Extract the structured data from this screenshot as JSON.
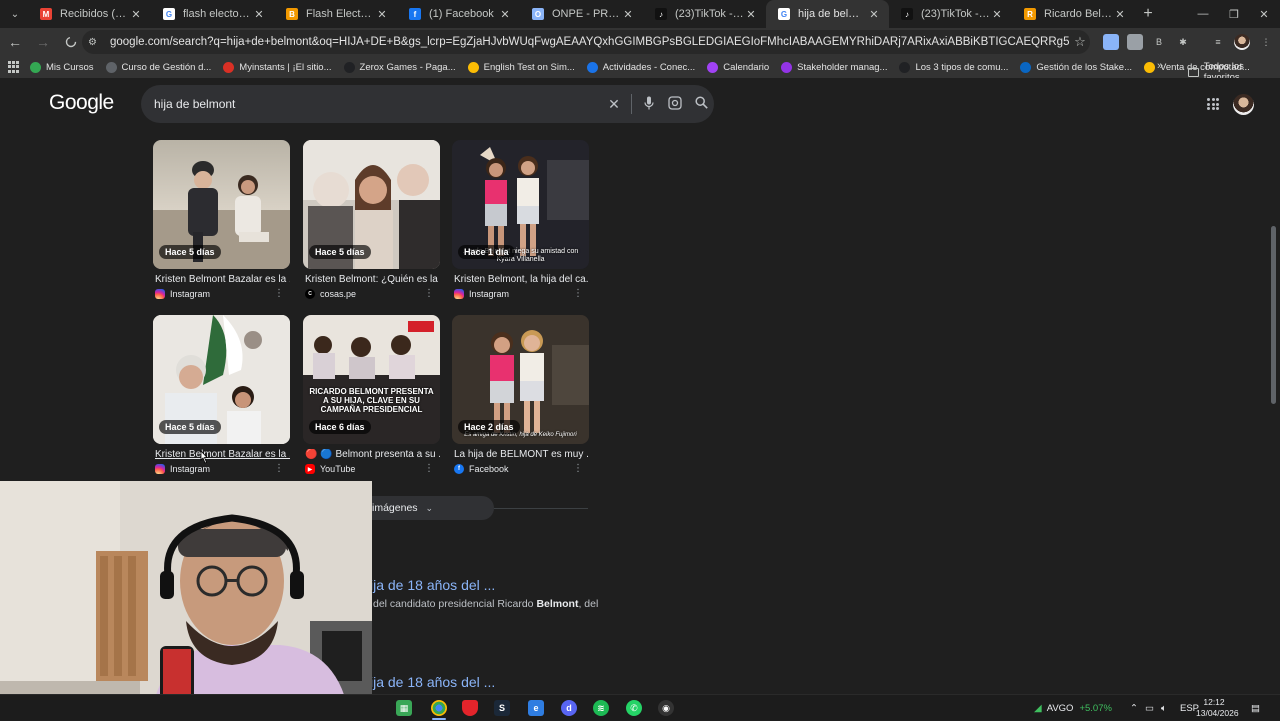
{
  "browser": {
    "tabs": [
      {
        "title": "Recibidos (15) - lgarc",
        "icon": "gmail-icon",
        "color": "#ea4335",
        "glyph": "M"
      },
      {
        "title": "flash electoral 2026 -",
        "icon": "google-icon",
        "color": "#ffffff",
        "glyph": "G"
      },
      {
        "title": "Flash Electoral a cont",
        "icon": "bookmark-orange-icon",
        "color": "#f29900",
        "glyph": "B"
      },
      {
        "title": "(1) Facebook",
        "icon": "facebook-icon",
        "color": "#1877f2",
        "glyph": "f"
      },
      {
        "title": "ONPE - PRESENTACIÓ",
        "icon": "page-icon",
        "color": "#8ab4f8",
        "glyph": "O"
      },
      {
        "title": "(23)TikTok - Make Yo",
        "icon": "tiktok-icon",
        "color": "#111111",
        "glyph": "♪"
      },
      {
        "title": "hija de belmont - Bus",
        "icon": "google-icon",
        "color": "#ffffff",
        "glyph": "G",
        "active": true
      },
      {
        "title": "(23)TikTok - Make Yo",
        "icon": "tiktok-icon",
        "color": "#111111",
        "glyph": "♪"
      },
      {
        "title": "Ricardo Belmont reve",
        "icon": "bookmark-orange-icon",
        "color": "#f29900",
        "glyph": "R"
      }
    ],
    "url": "google.com/search?q=hija+de+belmont&oq=HIJA+DE+B&gs_lcrp=EgZjaHJvbWUqFwgAEAAYQxhGGIMBGPsBGLEDGIAEGIoFMhcIABAAGEMYRhiDARj7ARixAxiABBiKBTIGCAEQRRg5MgcIAhAAGIAEMgcIAxAAGIAEMgcIBBAAGIAEMgc...",
    "bookmarks": [
      {
        "label": "Mis Cursos",
        "color": "#34a853"
      },
      {
        "label": "Curso de Gestión d...",
        "color": "#5f6368"
      },
      {
        "label": "Myinstants | ¡El sitio...",
        "color": "#d93025"
      },
      {
        "label": "Zerox Games - Paga...",
        "color": "#202124"
      },
      {
        "label": "English Test on Sim...",
        "color": "#fbbc04"
      },
      {
        "label": "Actividades - Conec...",
        "color": "#1a73e8"
      },
      {
        "label": "Calendario",
        "color": "#a142f4"
      },
      {
        "label": "Stakeholder manag...",
        "color": "#9334e6"
      },
      {
        "label": "Los 3 tipos de comu...",
        "color": "#202124"
      },
      {
        "label": "Gestión de los Stake...",
        "color": "#0a66c2"
      },
      {
        "label": "Venta de computad...",
        "color": "#fbbc04"
      }
    ],
    "all_bookmarks": "Todos los favoritos"
  },
  "search": {
    "logo": "Google",
    "query": "hija de belmont"
  },
  "images": [
    {
      "badge": "Hace 5 días",
      "title": "Kristen Belmont Bazalar es la ...",
      "source": "Instagram",
      "source_icon": "instagram-icon",
      "source_color": "#e1306c",
      "overlay": ""
    },
    {
      "badge": "Hace 5 días",
      "title": "Kristen Belmont: ¿Quién es la ...",
      "source": "cosas.pe",
      "source_icon": "cosas-icon",
      "source_color": "#444444",
      "overlay": ""
    },
    {
      "badge": "Hace 1 día",
      "title": "Kristen Belmont, la hija del ca...",
      "source": "Instagram",
      "source_icon": "instagram-icon",
      "source_color": "#e1306c",
      "overlay": "...ardo Belmont niega su amistad con Kyara Villanella"
    },
    {
      "badge": "Hace 5 días",
      "title": "Kristen Belmont Bazalar es la ...",
      "source": "Instagram",
      "source_icon": "instagram-icon",
      "source_color": "#e1306c",
      "overlay": ""
    },
    {
      "badge": "Hace 6 días",
      "title": "🔴 🔵 Belmont presenta a su ...",
      "source": "YouTube",
      "source_icon": "youtube-icon",
      "source_color": "#ff0000",
      "overlay": "RICARDO BELMONT PRESENTA A SU HIJA, CLAVE EN SU CAMPAÑA PRESIDENCIAL"
    },
    {
      "badge": "Hace 2 días",
      "title": "La hija de BELMONT es muy ...",
      "source": "Facebook",
      "source_icon": "facebook-icon",
      "source_color": "#1877f2",
      "overlay": "Es amiga de Kristin, hija de Keiko Fujimori"
    }
  ],
  "more_images": "imágenes",
  "results": [
    {
      "title": "ija de 18 años del ...",
      "snippet_pre": "del candidato presidencial Ricardo ",
      "snippet_bold": "Belmont",
      "snippet_post": ", del"
    },
    {
      "title": "ija de 18 años del ..."
    }
  ],
  "taskbar": {
    "stock_name": "AVGO",
    "stock_change": "+5.07%",
    "lang": "ESP",
    "time": "12:12",
    "date": "13/04/2026"
  }
}
